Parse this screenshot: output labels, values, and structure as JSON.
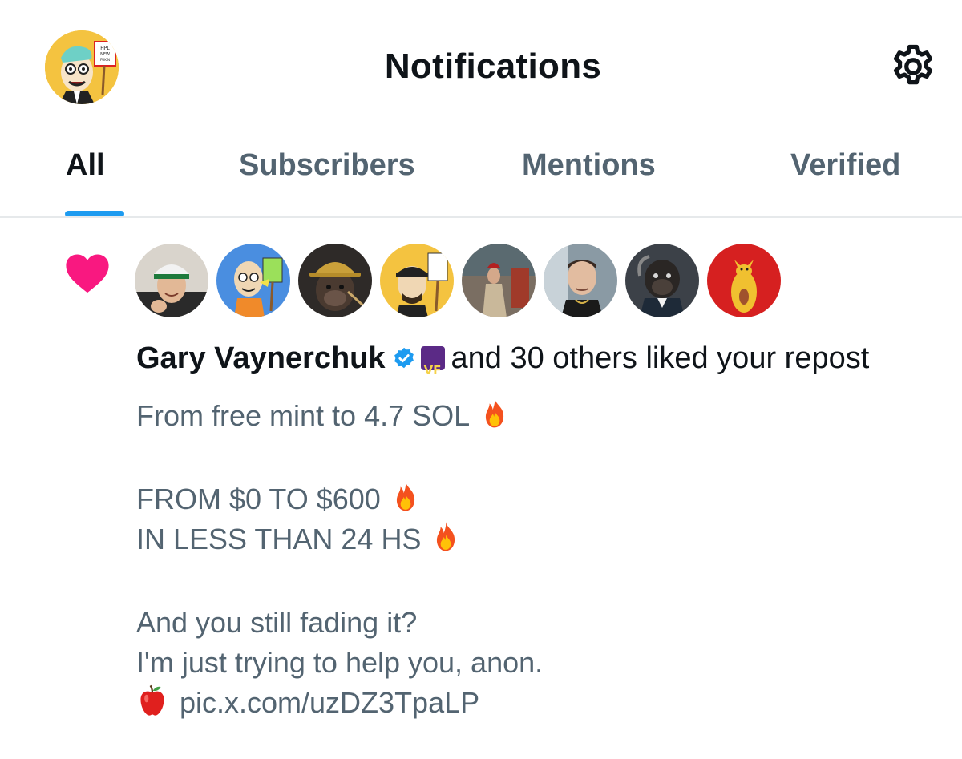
{
  "header": {
    "title": "Notifications",
    "avatar_sign_text": "HPL NEW FUKIN TRAH",
    "settings_icon": "gear-icon"
  },
  "tabs": [
    {
      "label": "All",
      "active": true
    },
    {
      "label": "Subscribers",
      "active": false
    },
    {
      "label": "Mentions",
      "active": false
    },
    {
      "label": "Verified",
      "active": false
    }
  ],
  "notification": {
    "type_icon": "heart-icon",
    "type_color": "#f91880",
    "liker_avatars": [
      {
        "name": "avatar-gary",
        "bg": "#d9d4cc"
      },
      {
        "name": "avatar-cartoon-bald",
        "bg": "#4a8ee0"
      },
      {
        "name": "avatar-gorilla-hat",
        "bg": "#3a3330"
      },
      {
        "name": "avatar-cartoon-cap",
        "bg": "#f4c340"
      },
      {
        "name": "avatar-photo-1",
        "bg": "#8a7c6e"
      },
      {
        "name": "avatar-photo-2",
        "bg": "#7c8c96"
      },
      {
        "name": "avatar-gorilla-suit",
        "bg": "#4a4e55"
      },
      {
        "name": "avatar-red-character",
        "bg": "#d62020"
      }
    ],
    "liker_name": "Gary Vaynerchuk",
    "verified_icon": "verified-badge-icon",
    "affiliate_badge": "VF",
    "action_text": "and 30 others liked your repost",
    "post_lines": [
      "From free mint to 4.7 SOL",
      "",
      "FROM $0 TO $600",
      "IN LESS THAN 24 HS",
      "",
      "And you still fading it?",
      "I'm just trying to help you, anon.",
      "pic.x.com/uzDZ3TpaLP"
    ]
  }
}
